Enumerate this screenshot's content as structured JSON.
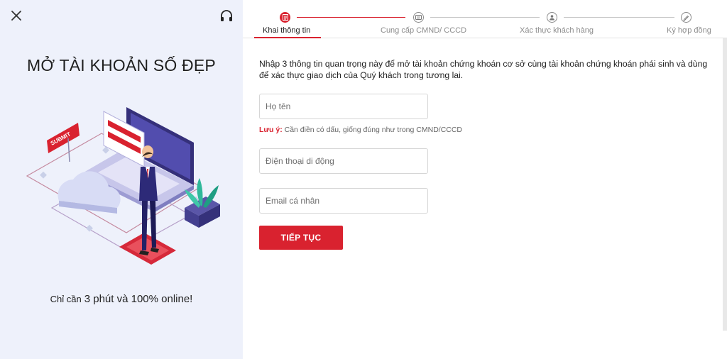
{
  "left_panel": {
    "title": "MỞ TÀI KHOẢN SỐ ĐẸP",
    "tagline_prefix": "Chỉ cần",
    "tagline_highlight": "3 phút và 100% online!",
    "illustration_label": "SUBMIT"
  },
  "icons": {
    "close": "close-icon",
    "support": "headset-icon"
  },
  "stepper": {
    "steps": [
      {
        "label": "Khai thông tin",
        "icon": "document-icon",
        "active": true
      },
      {
        "label": "Cung cấp CMND/ CCCD",
        "icon": "id-card-icon",
        "active": false
      },
      {
        "label": "Xác thực khách hàng",
        "icon": "user-icon",
        "active": false
      },
      {
        "label": "Ký hợp đồng",
        "icon": "pen-icon",
        "active": false
      }
    ]
  },
  "form": {
    "intro": "Nhập 3 thông tin quan trọng này để mở tài khoản chứng khoán cơ sở cùng tài khoản chứng khoán phái sinh và dùng để xác thực giao dịch của Quý khách trong tương lai.",
    "full_name_placeholder": "Họ tên",
    "full_name_value": "",
    "note_label": "Lưu ý:",
    "note_text": "Cần điền có dấu, giống đúng như trong CMND/CCCD",
    "phone_placeholder": "Điện thoại di động",
    "phone_value": "",
    "email_placeholder": "Email cá nhân",
    "email_value": "",
    "submit_label": "TIẾP TỤC"
  },
  "colors": {
    "accent": "#d9222f",
    "left_background": "#eef1fb",
    "text": "#222222"
  }
}
